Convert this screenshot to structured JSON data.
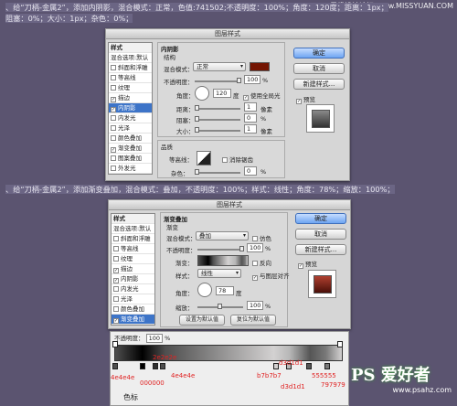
{
  "watermark_top": "思缘设计论坛 www.MISSYUAN.COM",
  "note1_line1": "、给“刀柄-金属2”，添加内阴影，混合模式：正常，色值:741502;不透明度：100%；角度：120度；距离：1px；",
  "note1_line2": "阻塞：0%；大小：1px；杂色：0%；",
  "note2": "、给“刀柄-金属2”，添加渐变叠加，混合模式：叠加，不透明度：100%；样式：线性；角度：78%；缩放：100%；",
  "dialog1": {
    "title": "图层样式",
    "styles": [
      "样式",
      "混合选项:默认",
      "斜面和浮雕",
      "等高线",
      "纹理",
      "描边",
      "内阴影",
      "内发光",
      "光泽",
      "颜色叠加",
      "渐变叠加",
      "图案叠加",
      "外发光"
    ],
    "styles_checked": [
      false,
      false,
      false,
      false,
      false,
      true,
      true,
      false,
      false,
      false,
      true,
      false,
      false
    ],
    "section": "内阴影",
    "sub": "结构",
    "blend_label": "混合模式：",
    "blend_value": "正常",
    "color": "#741502",
    "opacity_label": "不透明度：",
    "opacity_value": "100",
    "angle_label": "角度：",
    "angle_value": "120",
    "angle_unit": "度",
    "global_light": "使用全局光",
    "distance_label": "距离：",
    "distance_value": "1",
    "choke_label": "阻塞：",
    "choke_value": "0",
    "size_label": "大小：",
    "size_value": "1",
    "px": "像素",
    "pct": "%",
    "quality": "品质",
    "contour_label": "等高线：",
    "antialias": "消除锯齿",
    "noise_label": "杂色：",
    "noise_value": "0",
    "ok": "确定",
    "cancel": "取消",
    "new_style": "新建样式...",
    "preview": "预览"
  },
  "dialog2": {
    "title": "图层样式",
    "styles": [
      "样式",
      "混合选项:默认",
      "斜面和浮雕",
      "等高线",
      "纹理",
      "描边",
      "内阴影",
      "内发光",
      "光泽",
      "颜色叠加",
      "渐变叠加"
    ],
    "styles_checked": [
      false,
      false,
      false,
      false,
      false,
      true,
      true,
      false,
      false,
      false,
      true
    ],
    "section": "渐变叠加",
    "sub": "渐变",
    "blend_label": "混合模式：",
    "blend_value": "叠加",
    "dither": "仿色",
    "opacity_label": "不透明度：",
    "opacity_value": "100",
    "gradient_label": "渐变：",
    "reverse": "反向",
    "style_label": "样式：",
    "style_value": "线性",
    "align": "与图层对齐",
    "angle_label": "角度：",
    "angle_value": "78",
    "angle_unit": "度",
    "scale_label": "缩放：",
    "scale_value": "100",
    "pct": "%",
    "set_default": "设置为默认值",
    "reset_default": "复位为默认值",
    "ok": "确定",
    "cancel": "取消",
    "new_style": "新建样式...",
    "preview": "预览"
  },
  "gradient_editor": {
    "opacity_label": "不透明度：",
    "opacity_value": "100",
    "stops": [
      "4e4e4e",
      "000000",
      "2e2e2e",
      "4e4e4e",
      "d3d1d1",
      "b7b7b7",
      "555555",
      "797979",
      "d3d1d1"
    ],
    "color_label": "色标"
  },
  "site_logo": "PS 爱好者",
  "site_url": "www.psahz.com"
}
